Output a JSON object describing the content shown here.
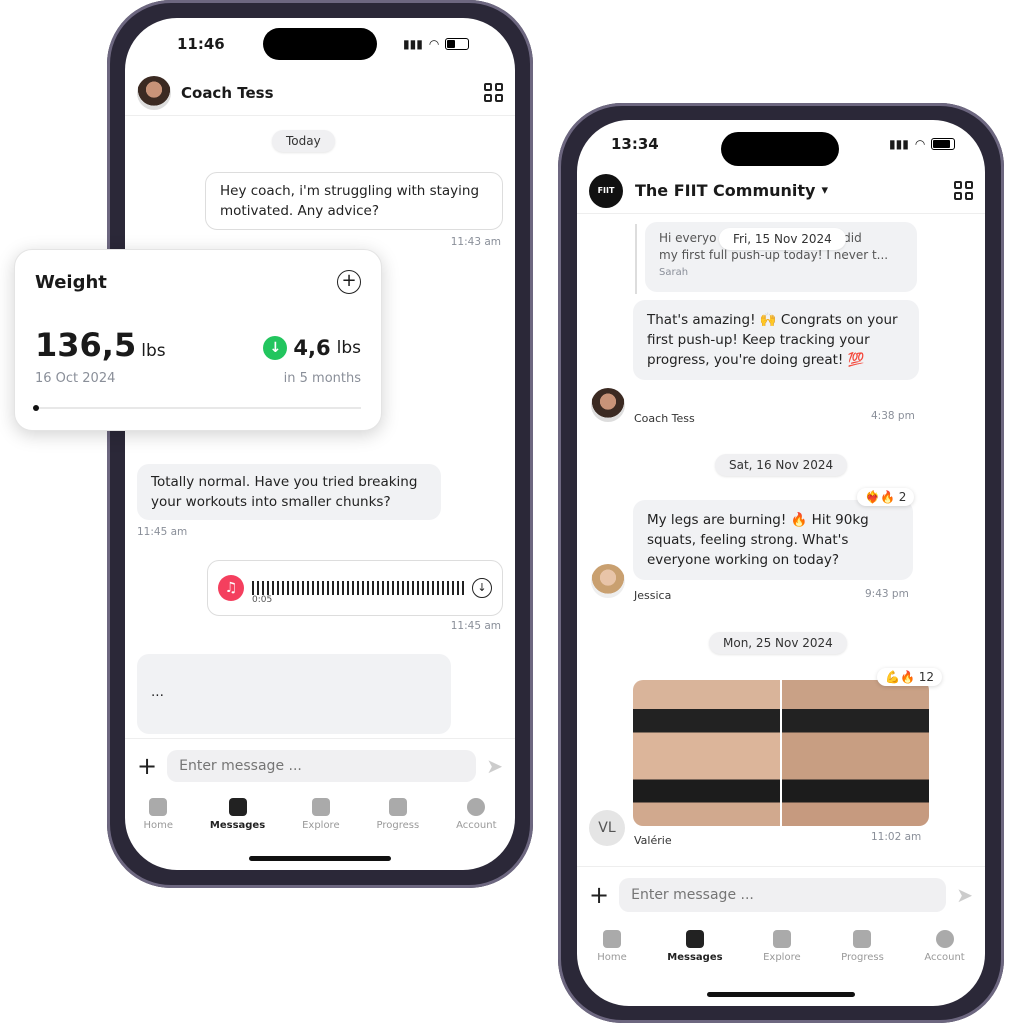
{
  "left_phone": {
    "status": {
      "time": "11:46"
    },
    "header": {
      "title": "Coach Tess",
      "grid_icon": "grid-icon"
    },
    "day_pill": "Today",
    "messages": [
      {
        "text": "Hey coach, i'm struggling with staying motivated. Any advice?",
        "time": "11:43 am",
        "direction": "out"
      },
      {
        "text": "Totally normal. Have you tried breaking your workouts into smaller chunks?",
        "time": "11:45 am",
        "direction": "in"
      },
      {
        "type": "voice",
        "duration": "0:05",
        "time": "11:45 am",
        "direction": "out"
      },
      {
        "text": "...",
        "direction": "in"
      }
    ],
    "input": {
      "placeholder": "Enter message ..."
    },
    "nav": [
      {
        "label": "Home"
      },
      {
        "label": "Messages",
        "active": true
      },
      {
        "label": "Explore"
      },
      {
        "label": "Progress"
      },
      {
        "label": "Account"
      }
    ]
  },
  "weight_card": {
    "title": "Weight",
    "value": "136,5",
    "unit": "lbs",
    "date": "16 Oct 2024",
    "change": "4,6",
    "change_unit": "lbs",
    "period": "in 5 months",
    "change_direction": "down",
    "accent": "#22c55e",
    "progress": 0
  },
  "right_phone": {
    "status": {
      "time": "13:34"
    },
    "header": {
      "logo": "FIIT",
      "title": "The FIIT Community",
      "chevron": "▾"
    },
    "floating_date": "Fri, 15 Nov 2024",
    "quoted": {
      "text_a": "Hi everyo",
      "text_b": "I just did",
      "text_line2": "my first full push-up today! I never t...",
      "author": "Sarah"
    },
    "messages": [
      {
        "text": "That's amazing! 🙌 Congrats on your first push-up! Keep tracking your progress, you're doing great! 💯",
        "author": "Coach Tess",
        "time": "4:38 pm"
      },
      {
        "date": "Sat, 16 Nov 2024"
      },
      {
        "text": "My legs are burning! 🔥 Hit 90kg squats, feeling strong. What's everyone working on today?",
        "author": "Jessica",
        "time": "9:43 pm",
        "reactions": "❤️‍🔥🔥",
        "reaction_count": "2"
      },
      {
        "date": "Mon, 25 Nov 2024"
      },
      {
        "type": "image",
        "author": "Valérie",
        "initials": "VL",
        "time": "11:02 am",
        "reactions": "💪🔥",
        "reaction_count": "12"
      }
    ],
    "input": {
      "placeholder": "Enter message ..."
    },
    "nav": [
      {
        "label": "Home"
      },
      {
        "label": "Messages",
        "active": true
      },
      {
        "label": "Explore"
      },
      {
        "label": "Progress"
      },
      {
        "label": "Account"
      }
    ]
  }
}
